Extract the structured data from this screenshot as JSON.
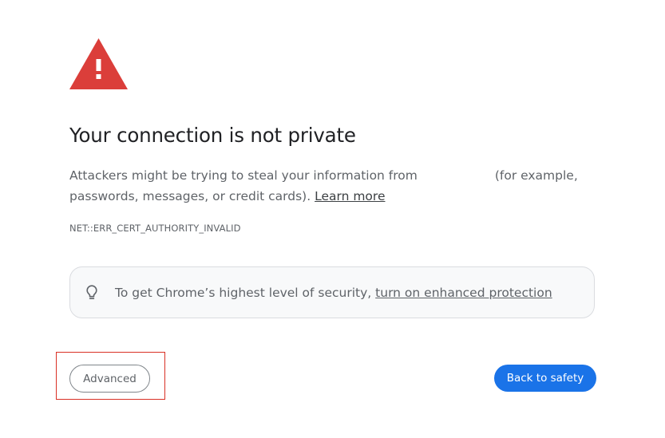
{
  "icon": "warning-triangle-icon",
  "title": "Your connection is not private",
  "explanation": {
    "line1_before": "Attackers might be trying to steal your information from",
    "line1_after": "(for example,",
    "line2_before": "passwords, messages, or credit cards).",
    "learn_more": "Learn more"
  },
  "error_code": "NET::ERR_CERT_AUTHORITY_INVALID",
  "enhanced": {
    "icon": "lightbulb-icon",
    "text": "To get Chrome’s highest level of security,",
    "link": "turn on enhanced protection"
  },
  "buttons": {
    "advanced": "Advanced",
    "back_to_safety": "Back to safety"
  },
  "colors": {
    "warning_red": "#db3e3a",
    "primary_blue": "#1a73e8",
    "highlight_red": "#d93025"
  }
}
